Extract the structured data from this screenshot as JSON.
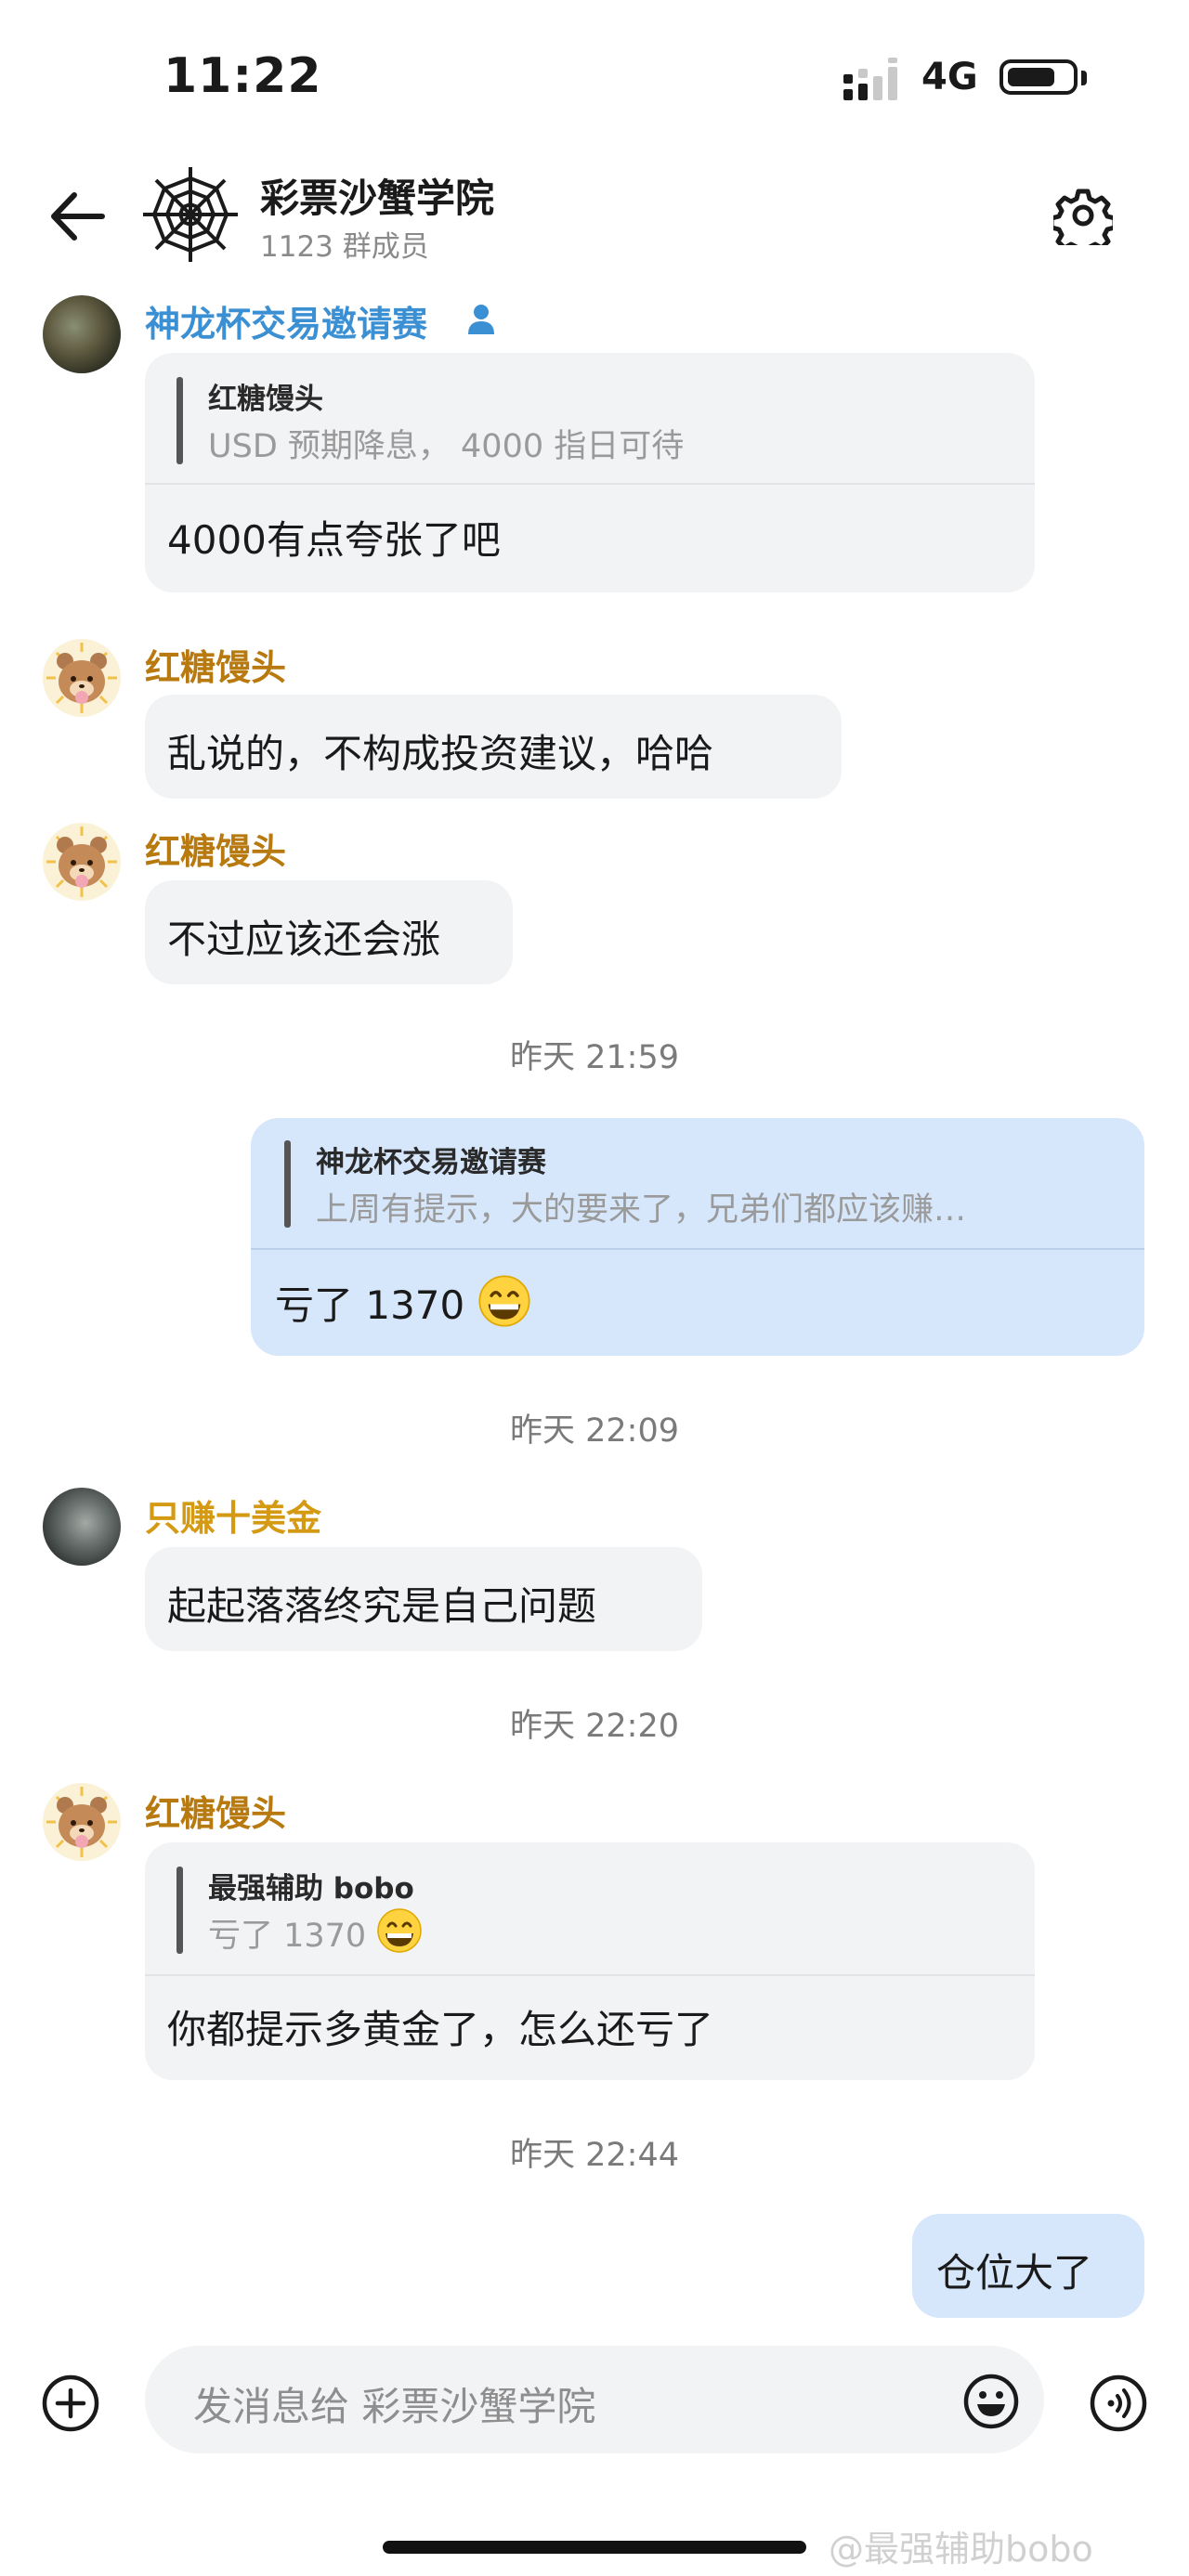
{
  "status_bar": {
    "time": "11:22",
    "network": "4G"
  },
  "header": {
    "title": "彩票沙蟹学院",
    "subtitle": "1123 群成员"
  },
  "messages": [
    {
      "sender": "神龙杯交易邀请赛",
      "quote_name": "红糖馒头",
      "quote_text": "USD 预期降息， 4000 指日可待",
      "text": "4000有点夸张了吧"
    },
    {
      "sender": "红糖馒头",
      "text": "乱说的，不构成投资建议，哈哈"
    },
    {
      "sender": "红糖馒头",
      "text": "不过应该还会涨"
    },
    {
      "timestamp": "昨天 21:59"
    },
    {
      "mine": true,
      "quote_name": "神龙杯交易邀请赛",
      "quote_text": "上周有提示，大的要来了，兄弟们都应该赚…",
      "text": "亏了 1370"
    },
    {
      "timestamp": "昨天 22:09"
    },
    {
      "sender": "只赚十美金",
      "text": "起起落落终究是自己问题"
    },
    {
      "timestamp": "昨天 22:20"
    },
    {
      "sender": "红糖馒头",
      "quote_name": "最强辅助 bobo",
      "quote_text": "亏了 1370",
      "text": "你都提示多黄金了，怎么还亏了"
    },
    {
      "timestamp": "昨天 22:44"
    },
    {
      "mine": true,
      "text": "仓位大了"
    }
  ],
  "input": {
    "placeholder": "发消息给 彩票沙蟹学院"
  },
  "watermark": "@最强辅助bobo",
  "icons": [
    "back-arrow-icon",
    "spider-web-icon",
    "gear-icon",
    "member-icon",
    "grin-emoji",
    "plus-icon",
    "emoji-icon",
    "voice-icon"
  ],
  "colors": {
    "sender_blue": "#3b8fd3",
    "sender_gold": "#b8790f",
    "my_bubble": "#d6e6fb",
    "other_bubble": "#f2f3f5"
  }
}
